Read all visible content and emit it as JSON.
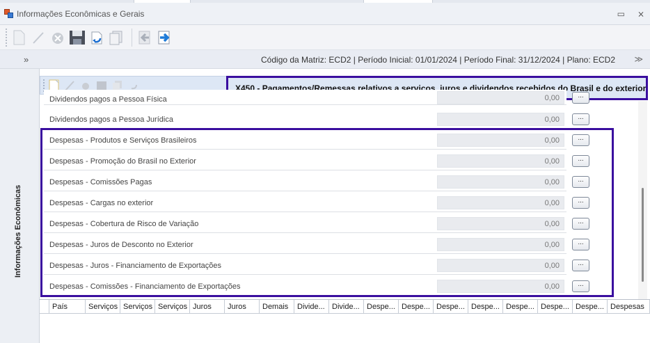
{
  "window": {
    "title": "Informações Econômicas e Gerais",
    "minimize_glyph": "▭",
    "close_glyph": "⨯"
  },
  "toolbar": {
    "buttons": [
      "new-icon",
      "edit-icon",
      "delete-icon",
      "save-icon",
      "undo-icon",
      "copy-icon",
      "back-icon",
      "forward-icon"
    ]
  },
  "infobar": {
    "expand_glyph": "»",
    "text": "Código da Matriz: ECD2 | Período Inicial: 01/01/2024 | Período Final: 31/12/2024 | Plano: ECD2",
    "collapse_glyph": "≫"
  },
  "nav": {
    "vertical_label": "Informações Econômicas"
  },
  "section": {
    "title": "X450 - Pagamentos/Remessas relativos a serviços, juros e dividendos recebidos do Brasil e do exterior"
  },
  "rows": [
    {
      "label": "Dividendos pagos a Pessoa Física",
      "value": "0,00",
      "button": "..."
    },
    {
      "label": "Dividendos pagos a Pessoa Jurídica",
      "value": "0,00",
      "button": "..."
    },
    {
      "label": "Despesas - Produtos e Serviços Brasileiros",
      "value": "0,00",
      "button": "..."
    },
    {
      "label": "Despesas - Promoção do Brasil no Exterior",
      "value": "0,00",
      "button": "..."
    },
    {
      "label": "Despesas - Comissões Pagas",
      "value": "0,00",
      "button": "..."
    },
    {
      "label": "Despesas - Cargas no exterior",
      "value": "0,00",
      "button": "..."
    },
    {
      "label": "Despesas - Cobertura de Risco de Variação",
      "value": "0,00",
      "button": "..."
    },
    {
      "label": "Despesas - Juros de Desconto no Exterior",
      "value": "0,00",
      "button": "..."
    },
    {
      "label": "Despesas - Juros - Financiamento de Exportações",
      "value": "0,00",
      "button": "..."
    },
    {
      "label": "Despesas - Comissões - Financiamento de Exportações",
      "value": "0,00",
      "button": "..."
    }
  ],
  "grid": {
    "columns": [
      "País",
      "Serviços",
      "Serviços",
      "Serviços",
      "Juros",
      "Juros",
      "Demais",
      "Divide...",
      "Divide...",
      "Despe...",
      "Despe...",
      "Despe...",
      "Despe...",
      "Despe...",
      "Despe...",
      "Despe...",
      "Despesas"
    ]
  },
  "colors": {
    "highlight": "#3a0e9f",
    "accent": "#dde7f5"
  }
}
